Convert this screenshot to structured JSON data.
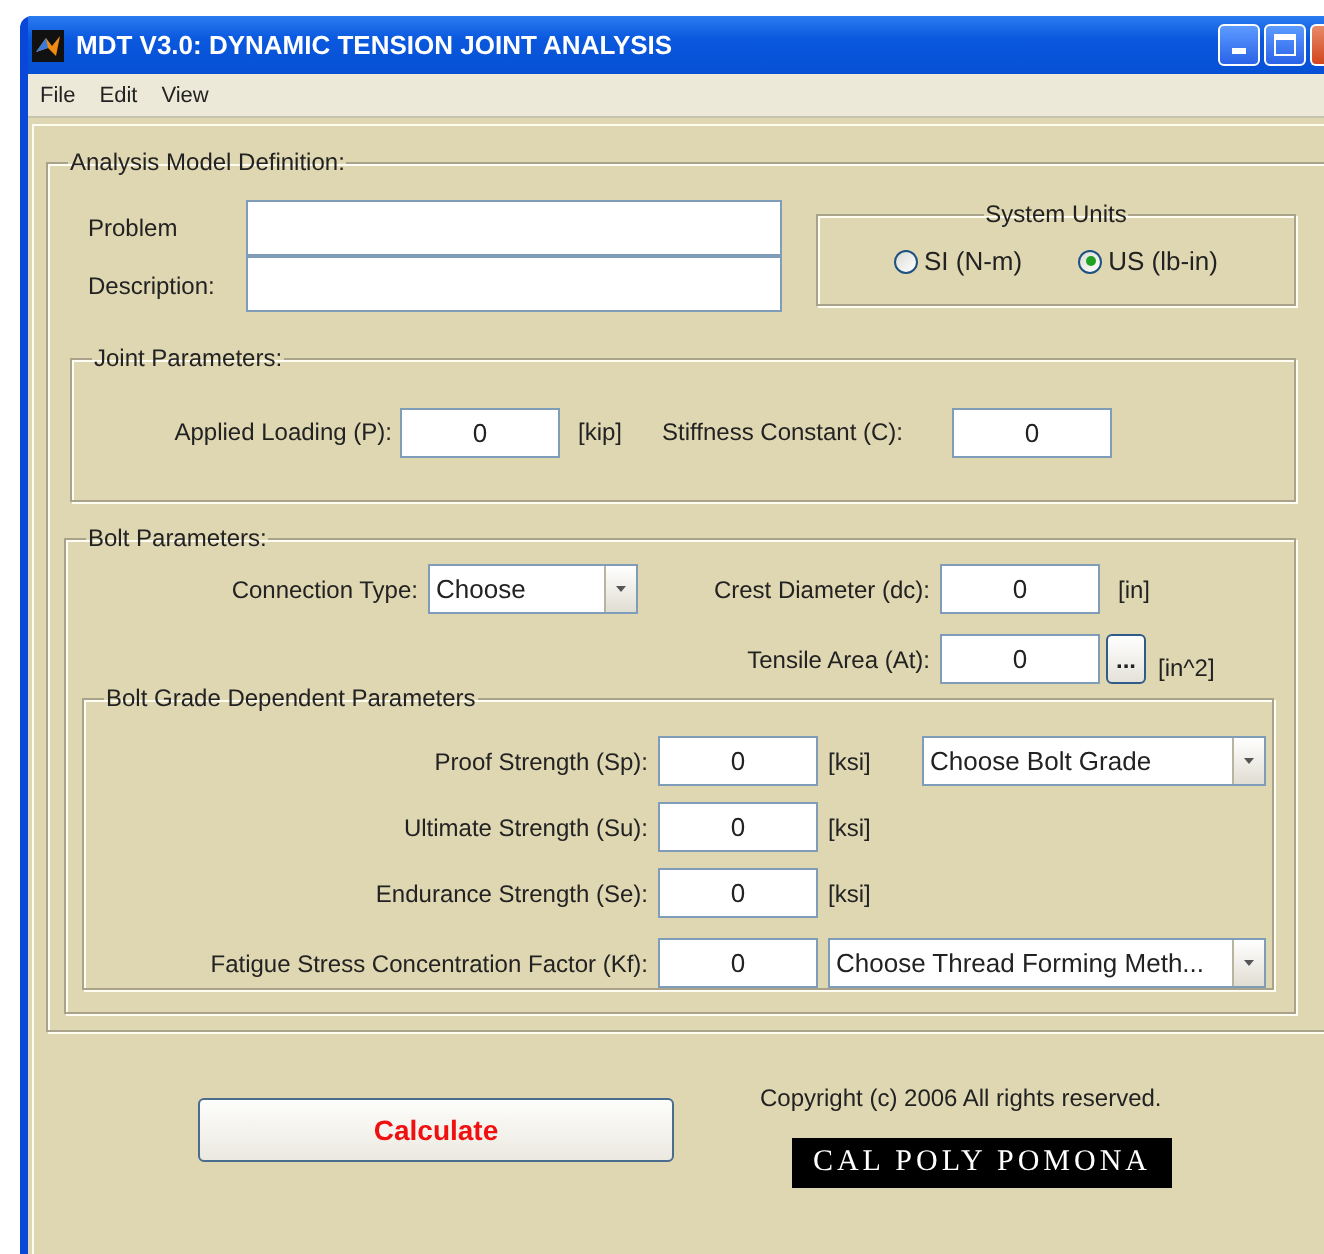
{
  "window": {
    "title": "MDT V3.0: DYNAMIC TENSION JOINT ANALYSIS"
  },
  "menu": [
    "File",
    "Edit",
    "View"
  ],
  "analysis_model": {
    "legend": "Analysis Model Definition:",
    "fields": [
      {
        "label": "Problem"
      },
      {
        "label": "Description:"
      }
    ]
  },
  "system_units": {
    "legend": "System Units",
    "options": [
      {
        "label": "SI (N-m)",
        "selected": false
      },
      {
        "label": "US (lb-in)",
        "selected": true
      }
    ]
  },
  "joint_parameters": {
    "legend": "Joint Parameters:",
    "fields": [
      {
        "label": "Applied Loading (P):",
        "value": "0",
        "unit": "[kip]"
      },
      {
        "label": "Stiffness Constant (C):",
        "value": "0"
      }
    ]
  },
  "bolt_parameters": {
    "legend": "Bolt Parameters:",
    "connection_type": {
      "label": "Connection Type:",
      "value": "Choose"
    },
    "crest_diameter": {
      "label": "Crest Diameter (dc):",
      "value": "0",
      "unit": "[in]"
    },
    "tensile_area": {
      "label": "Tensile Area (At):",
      "value": "0",
      "button": "...",
      "unit": "[in^2]"
    }
  },
  "bolt_grade": {
    "legend": "Bolt Grade Dependent Parameters",
    "rows": [
      {
        "label": "Proof Strength (Sp):",
        "value": "0",
        "unit": "[ksi]",
        "dropdown": "Choose Bolt Grade"
      },
      {
        "label": "Ultimate Strength (Su):",
        "value": "0",
        "unit": "[ksi]"
      },
      {
        "label": "Endurance Strength (Se):",
        "value": "0",
        "unit": "[ksi]"
      },
      {
        "label": "Fatigue Stress Concentration Factor (Kf):",
        "value": "0",
        "dropdown": "Choose Thread Forming Meth..."
      }
    ]
  },
  "calculate_button": "Calculate",
  "copyright": "Copyright (c) 2006 All rights reserved.",
  "logo": "CAL POLY POMONA"
}
